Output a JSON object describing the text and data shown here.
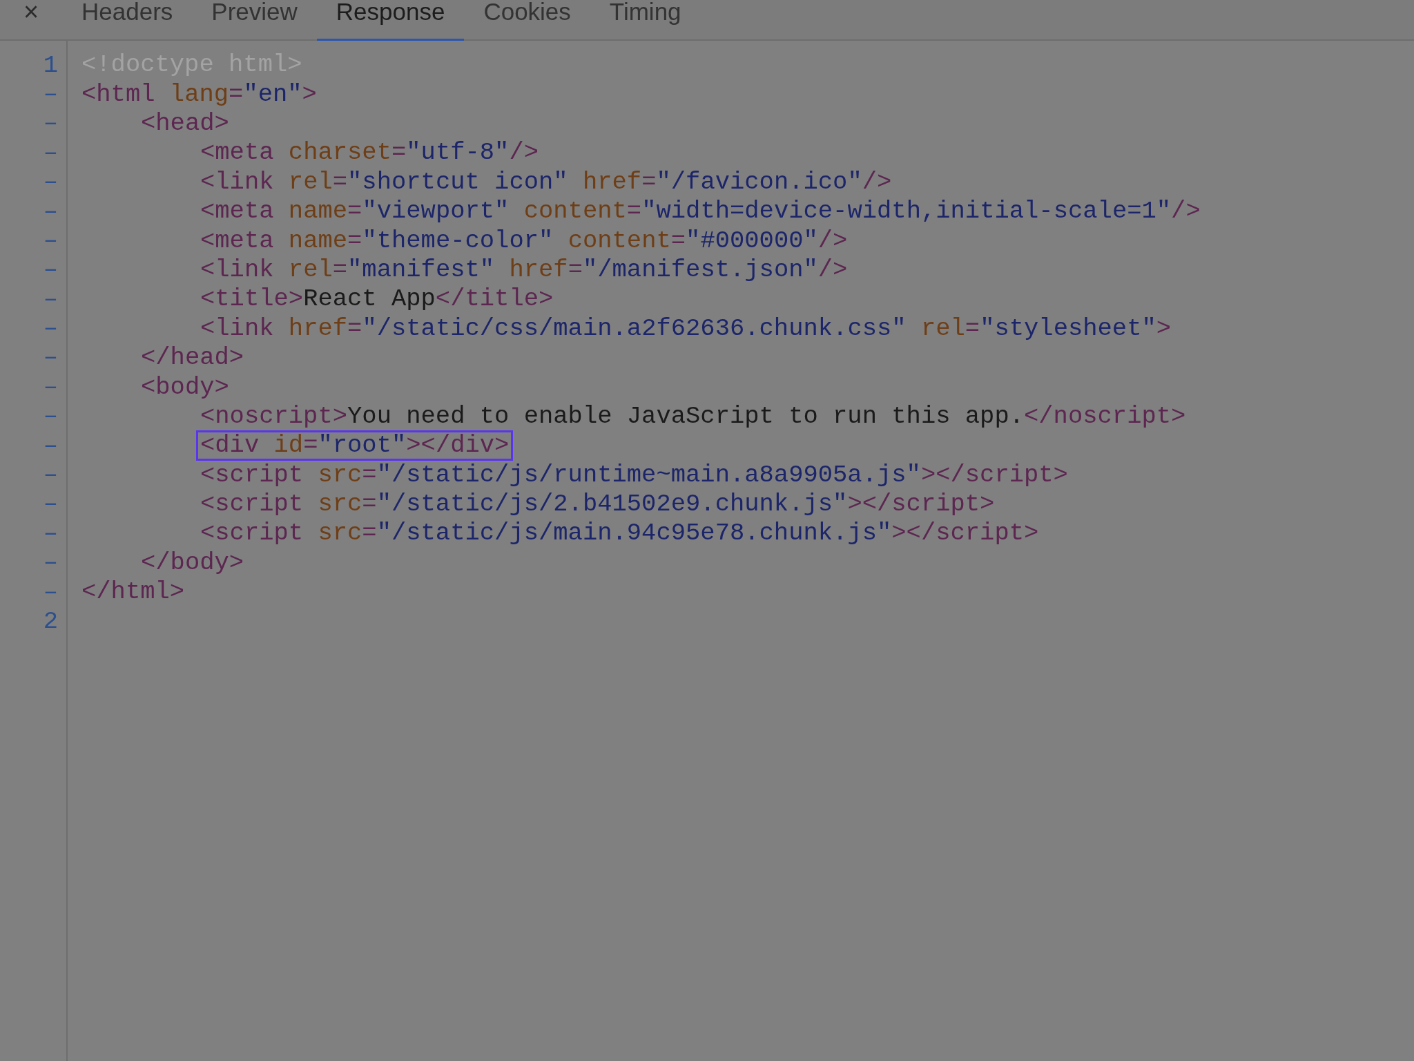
{
  "close": "×",
  "tabs": [
    {
      "label": "Headers",
      "selected": false
    },
    {
      "label": "Preview",
      "selected": false
    },
    {
      "label": "Response",
      "selected": true
    },
    {
      "label": "Cookies",
      "selected": false
    },
    {
      "label": "Timing",
      "selected": false
    }
  ],
  "lines": [
    {
      "gutter": "1",
      "highlighted": false,
      "tokens": [
        {
          "kind": "doctype",
          "text": "<!doctype html>"
        }
      ]
    },
    {
      "gutter": "–",
      "highlighted": false,
      "tokens": [
        {
          "kind": "tag",
          "text": "<html"
        },
        {
          "kind": "attr",
          "text": " lang"
        },
        {
          "kind": "tag",
          "text": "="
        },
        {
          "kind": "value",
          "text": "\"en\""
        },
        {
          "kind": "tag",
          "text": ">"
        }
      ],
      "children": [
        {
          "gutter": "–",
          "highlighted": false,
          "tokens": [
            {
              "kind": "tag",
              "text": "<head>"
            }
          ],
          "children": [
            {
              "gutter": "–",
              "highlighted": false,
              "tokens": [
                {
                  "kind": "tag",
                  "text": "<meta"
                },
                {
                  "kind": "attr",
                  "text": " charset"
                },
                {
                  "kind": "tag",
                  "text": "="
                },
                {
                  "kind": "value",
                  "text": "\"utf-8\""
                },
                {
                  "kind": "tag",
                  "text": "/>"
                }
              ]
            },
            {
              "gutter": "–",
              "highlighted": false,
              "tokens": [
                {
                  "kind": "tag",
                  "text": "<link"
                },
                {
                  "kind": "attr",
                  "text": " rel"
                },
                {
                  "kind": "tag",
                  "text": "="
                },
                {
                  "kind": "value",
                  "text": "\"shortcut icon\""
                },
                {
                  "kind": "attr",
                  "text": " href"
                },
                {
                  "kind": "tag",
                  "text": "="
                },
                {
                  "kind": "value",
                  "text": "\"/favicon.ico\""
                },
                {
                  "kind": "tag",
                  "text": "/>"
                }
              ]
            },
            {
              "gutter": "–",
              "highlighted": false,
              "tokens": [
                {
                  "kind": "tag",
                  "text": "<meta"
                },
                {
                  "kind": "attr",
                  "text": " name"
                },
                {
                  "kind": "tag",
                  "text": "="
                },
                {
                  "kind": "value",
                  "text": "\"viewport\""
                },
                {
                  "kind": "attr",
                  "text": " content"
                },
                {
                  "kind": "tag",
                  "text": "="
                },
                {
                  "kind": "value",
                  "text": "\"width=device-width,initial-scale=1\""
                },
                {
                  "kind": "tag",
                  "text": "/>"
                }
              ]
            },
            {
              "gutter": "–",
              "highlighted": false,
              "tokens": [
                {
                  "kind": "tag",
                  "text": "<meta"
                },
                {
                  "kind": "attr",
                  "text": " name"
                },
                {
                  "kind": "tag",
                  "text": "="
                },
                {
                  "kind": "value",
                  "text": "\"theme-color\""
                },
                {
                  "kind": "attr",
                  "text": " content"
                },
                {
                  "kind": "tag",
                  "text": "="
                },
                {
                  "kind": "value",
                  "text": "\"#000000\""
                },
                {
                  "kind": "tag",
                  "text": "/>"
                }
              ]
            },
            {
              "gutter": "–",
              "highlighted": false,
              "tokens": [
                {
                  "kind": "tag",
                  "text": "<link"
                },
                {
                  "kind": "attr",
                  "text": " rel"
                },
                {
                  "kind": "tag",
                  "text": "="
                },
                {
                  "kind": "value",
                  "text": "\"manifest\""
                },
                {
                  "kind": "attr",
                  "text": " href"
                },
                {
                  "kind": "tag",
                  "text": "="
                },
                {
                  "kind": "value",
                  "text": "\"/manifest.json\""
                },
                {
                  "kind": "tag",
                  "text": "/>"
                }
              ]
            },
            {
              "gutter": "–",
              "highlighted": false,
              "tokens": [
                {
                  "kind": "tag",
                  "text": "<title>"
                },
                {
                  "kind": "text",
                  "text": "React App"
                },
                {
                  "kind": "tag",
                  "text": "</title>"
                }
              ]
            },
            {
              "gutter": "–",
              "highlighted": false,
              "tokens": [
                {
                  "kind": "tag",
                  "text": "<link"
                },
                {
                  "kind": "attr",
                  "text": " href"
                },
                {
                  "kind": "tag",
                  "text": "="
                },
                {
                  "kind": "value",
                  "text": "\"/static/css/main.a2f62636.chunk.css\""
                },
                {
                  "kind": "attr",
                  "text": " rel"
                },
                {
                  "kind": "tag",
                  "text": "="
                },
                {
                  "kind": "value",
                  "text": "\"stylesheet\""
                },
                {
                  "kind": "tag",
                  "text": ">"
                }
              ]
            }
          ]
        },
        {
          "gutter": "–",
          "highlighted": false,
          "tokens": [
            {
              "kind": "tag",
              "text": "</head>"
            }
          ]
        },
        {
          "gutter": "–",
          "highlighted": false,
          "tokens": [
            {
              "kind": "tag",
              "text": "<body>"
            }
          ],
          "children": [
            {
              "gutter": "–",
              "highlighted": false,
              "tokens": [
                {
                  "kind": "tag",
                  "text": "<noscript>"
                },
                {
                  "kind": "text",
                  "text": "You need to enable JavaScript to run this app."
                },
                {
                  "kind": "tag",
                  "text": "</noscript>"
                }
              ]
            },
            {
              "gutter": "–",
              "highlighted": true,
              "tokens": [
                {
                  "kind": "tag",
                  "text": "<div"
                },
                {
                  "kind": "attr",
                  "text": " id"
                },
                {
                  "kind": "tag",
                  "text": "="
                },
                {
                  "kind": "value",
                  "text": "\"root\""
                },
                {
                  "kind": "tag",
                  "text": "></div>"
                }
              ]
            },
            {
              "gutter": "–",
              "highlighted": false,
              "tokens": [
                {
                  "kind": "tag",
                  "text": "<script"
                },
                {
                  "kind": "attr",
                  "text": " src"
                },
                {
                  "kind": "tag",
                  "text": "="
                },
                {
                  "kind": "value",
                  "text": "\"/static/js/runtime~main.a8a9905a.js\""
                },
                {
                  "kind": "tag",
                  "text": "></script>"
                }
              ]
            },
            {
              "gutter": "–",
              "highlighted": false,
              "tokens": [
                {
                  "kind": "tag",
                  "text": "<script"
                },
                {
                  "kind": "attr",
                  "text": " src"
                },
                {
                  "kind": "tag",
                  "text": "="
                },
                {
                  "kind": "value",
                  "text": "\"/static/js/2.b41502e9.chunk.js\""
                },
                {
                  "kind": "tag",
                  "text": "></script>"
                }
              ]
            },
            {
              "gutter": "–",
              "highlighted": false,
              "tokens": [
                {
                  "kind": "tag",
                  "text": "<script"
                },
                {
                  "kind": "attr",
                  "text": " src"
                },
                {
                  "kind": "tag",
                  "text": "="
                },
                {
                  "kind": "value",
                  "text": "\"/static/js/main.94c95e78.chunk.js\""
                },
                {
                  "kind": "tag",
                  "text": "></script>"
                }
              ]
            }
          ]
        },
        {
          "gutter": "–",
          "highlighted": false,
          "tokens": [
            {
              "kind": "tag",
              "text": "</body>"
            }
          ]
        }
      ]
    },
    {
      "gutter": "–",
      "highlighted": false,
      "tokens": [
        {
          "kind": "tag",
          "text": "</html>"
        }
      ]
    },
    {
      "gutter": "2"
    }
  ]
}
